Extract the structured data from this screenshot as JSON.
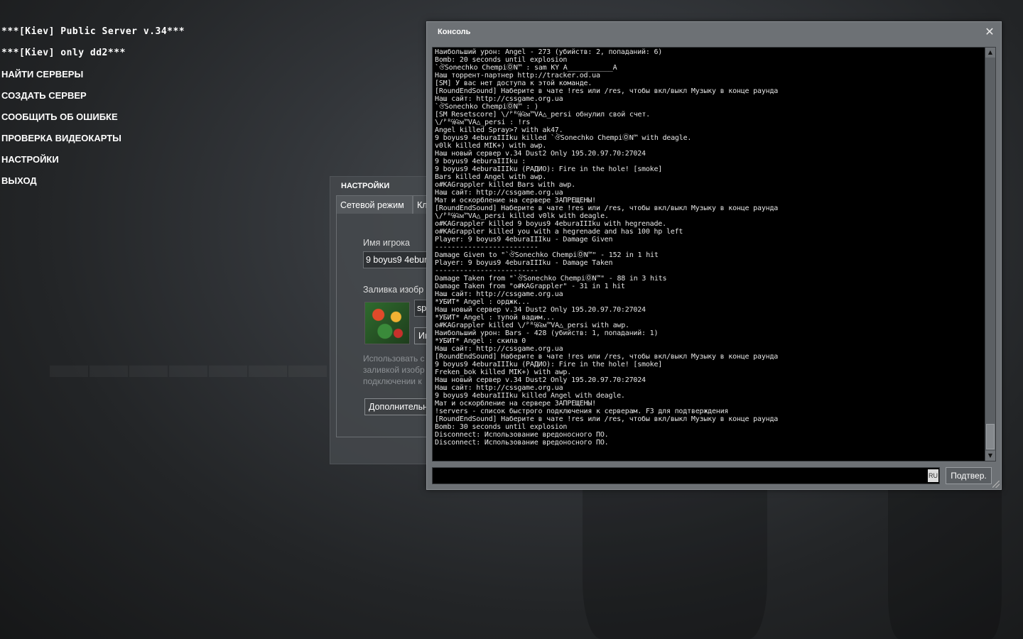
{
  "menu": {
    "items": [
      "***[Kiev] Public Server v.34***",
      "***[Kiev] only dd2***",
      "НАЙТИ СЕРВЕРЫ",
      "СОЗДАТЬ СЕРВЕР",
      "СООБЩИТЬ ОБ ОШИБКЕ",
      "ПРОВЕРКА ВИДЕОКАРТЫ",
      "НАСТРОЙКИ",
      "ВЫХОД"
    ]
  },
  "settings": {
    "title": "НАСТРОЙКИ",
    "tabs": [
      "Сетевой режим",
      "Кл"
    ],
    "player_name_label": "Имя игрока",
    "player_name_value": "9 boyus9 4ebur",
    "spray_label": "Заливка изобр",
    "spray_field": "sp",
    "import_button": "Им",
    "note_lines": [
      "Использовать с",
      "заливкой изобр",
      "подключении к"
    ],
    "advanced_button": "Дополнительн"
  },
  "console": {
    "title": "Консоль",
    "close": "✕",
    "submit_label": "Подтвер.",
    "lang_badge": "RU",
    "lines": [
      "Наибольший урон: Angel - 273 (убийств: 2, попаданий: 6)",
      "Bomb: 20 seconds until explosion",
      "`ঔSonechko ChempiⓄN™ :  sam KY A___________A",
      "Наш торрент-партнер http://tracker.od.ua",
      "[SM] У вас нет доступа к этой команде.",
      "[RoundEndSound] Наберите в чате !res или /res, чтобы вкл/выкл Музыку в конце раунда",
      "Наш сайт: http://cssgame.org.ua",
      "`ঔSonechko ChempiⓄN™ :  )",
      "[SM Resetscore] \\/ᴾᴿ℅₠ᴍ™VA△_persi обнулил свой счет.",
      "\\/ᴾᴿ℅₠ᴍ™VA△_persi :  !rs",
      "Angel killed Spray>? with ak47.",
      "9 boyus9 4eburaIIIku killed `ঔSonechko ChempiⓄN™ with deagle.",
      "v0lk killed MIK+) with awp.",
      "Наш новый сервер v.34  Dust2 Only 195.20.97.70:27024",
      "9 boyus9 4eburaIIIku :",
      "9 boyus9 4eburaIIIku (РАДИО): Fire in the hole! [smoke]",
      "Bars killed Angel with awp.",
      "o#KAGrappler killed Bars with awp.",
      "Наш сайт: http://cssgame.org.ua",
      "Мат и оскорбление на сервере ЗАПРЕЩЕНЫ!",
      "[RoundEndSound] Наберите в чате !res или /res, чтобы вкл/выкл Музыку в конце раунда",
      "\\/ᴾᴿ℅₠ᴍ™VA△_persi killed v0lk with deagle.",
      "o#KAGrappler killed 9 boyus9 4eburaIIIku with hegrenade.",
      "o#KAGrappler killed you with a hegrenade and has 100 hp left",
      "Player: 9 boyus9 4eburaIIIku - Damage Given",
      "-------------------------",
      "Damage Given to \"`ঔSonechko ChempiⓄN™\" - 152 in 1 hit",
      "Player: 9 boyus9 4eburaIIIku - Damage Taken",
      "-------------------------",
      "Damage Taken from \"`ঔSonechko ChempiⓄN™\" - 88 in 3 hits",
      "Damage Taken from \"o#KAGrappler\" - 31 in 1 hit",
      "Наш сайт: http://cssgame.org.ua",
      "*УБИТ* Angel :  орджк...",
      "Наш новый сервер v.34  Dust2 Only 195.20.97.70:27024",
      "*УБИТ* Angel :  тупой вадим...",
      "o#KAGrappler killed \\/ᴾᴿ℅₠ᴍ™VA△_persi with awp.",
      "Наибольший урон: Bars - 428 (убийств: 1, попаданий: 1)",
      "*УБИТ* Angel :  скила 0",
      "Наш сайт: http://cssgame.org.ua",
      "[RoundEndSound] Наберите в чате !res или /res, чтобы вкл/выкл Музыку в конце раунда",
      "9 boyus9 4eburaIIIku (РАДИО): Fire in the hole! [smoke]",
      "Freken_bok killed MIK+) with awp.",
      "Наш новый сервер v.34  Dust2 Only 195.20.97.70:27024",
      "Наш сайт: http://cssgame.org.ua",
      "9 boyus9 4eburaIIIku killed Angel with deagle.",
      "Мат и оскорбление на сервере ЗАПРЕЩЕНЫ!",
      "!servers - список быстрого подключения к серверам. F3 для подтверждения",
      "[RoundEndSound] Наберите в чате !res или /res, чтобы вкл/выкл Музыку в конце раунда",
      "Bomb: 30 seconds until explosion",
      "Disconnect: Использование вредоносного ПО.",
      "Disconnect: Использование вредоносного ПО."
    ]
  }
}
